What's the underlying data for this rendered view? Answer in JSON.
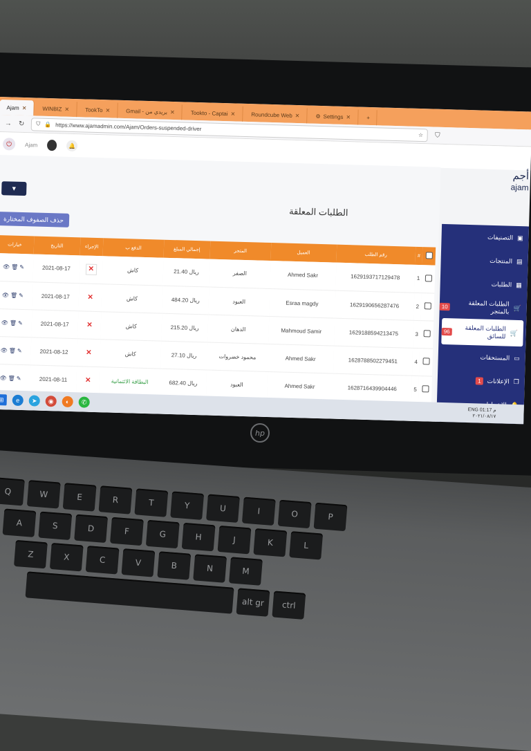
{
  "browser": {
    "tabs": [
      {
        "label": "Ajam"
      },
      {
        "label": "WINBIZ"
      },
      {
        "label": "TookTo"
      },
      {
        "label": "Gmail - بريدي من"
      },
      {
        "label": "Tookto - Captai"
      },
      {
        "label": "Roundcube Web"
      },
      {
        "label": "Settings"
      }
    ],
    "url": "https://www.ajamadmin.com/Ajam/Orders-suspended-driver"
  },
  "topbar": {
    "admin_name": "Ajam"
  },
  "brand": {
    "logo_ar": "أجم",
    "logo_en": "ajam"
  },
  "page": {
    "title": "الطلبات المعلقة",
    "delete_selected": "حذف الصفوف المختارة",
    "filter_icon": "▼"
  },
  "table": {
    "headers": [
      "#",
      "رقم الطلب",
      "العميل",
      "المتجر",
      "إجمالي المبلغ",
      "الدفع ب",
      "الإجراء",
      "التاريخ",
      "خيارات"
    ],
    "rows": [
      {
        "n": "1",
        "order_id": "1629193717129478",
        "customer": "Ahmed Sakr",
        "store": "الصفر",
        "total": "21.40",
        "currency": "ريال",
        "payment": "كاش",
        "date": "2021-08-17"
      },
      {
        "n": "2",
        "order_id": "1629190656287476",
        "customer": "Esraa magdy",
        "store": "العبود",
        "total": "484.20",
        "currency": "ريال",
        "payment": "كاش",
        "date": "2021-08-17"
      },
      {
        "n": "3",
        "order_id": "1629188594213475",
        "customer": "Mahmoud Samir",
        "store": "الدهان",
        "total": "215.20",
        "currency": "ريال",
        "payment": "كاش",
        "date": "2021-08-17"
      },
      {
        "n": "4",
        "order_id": "1628788502279451",
        "customer": "Ahmed Sakr",
        "store": "محمود خضروات",
        "total": "27.10",
        "currency": "ريال",
        "payment": "كاش",
        "date": "2021-08-12"
      },
      {
        "n": "5",
        "order_id": "1628716439904446",
        "customer": "Ahmed Sakr",
        "store": "العبود",
        "total": "682.40",
        "currency": "ريال",
        "payment": "البطاقة الائتمانية",
        "date": "2021-08-11"
      }
    ]
  },
  "sidebar": {
    "items": [
      {
        "label": "التصنيفات",
        "badge": ""
      },
      {
        "label": "المنتجات",
        "badge": ""
      },
      {
        "label": "الطلبات",
        "badge": ""
      },
      {
        "label": "الطلبات المعلقة بالمتجر",
        "badge": "10"
      },
      {
        "label": "الطلبات المعلقة للسائق",
        "badge": "96"
      },
      {
        "label": "المستحقات",
        "badge": ""
      },
      {
        "label": "الإعلانات",
        "badge": "1"
      },
      {
        "label": "الإشعارات",
        "badge": ""
      }
    ]
  },
  "taskbar": {
    "time": "01:17 م",
    "date": "٢٠٢١/٠٨/١٧",
    "lang": "ENG"
  },
  "colors": {
    "accent": "#f08a2a",
    "sidebar": "#25307a",
    "badge": "#e34b4b",
    "delete_btn": "#6a78c6"
  }
}
